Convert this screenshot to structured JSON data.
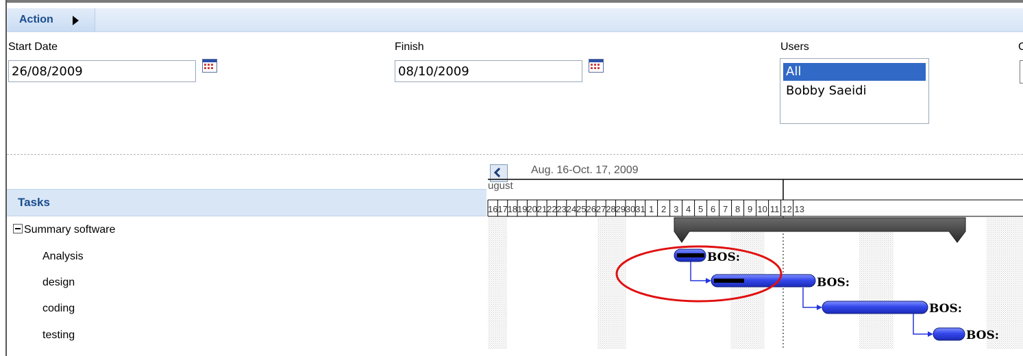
{
  "toolbar": {
    "action_label": "Action"
  },
  "filters": {
    "start_label": "Start Date",
    "start_value": "26/08/2009",
    "finish_label": "Finish",
    "finish_value": "08/10/2009",
    "users_label": "Users",
    "users_options": [
      "All",
      "Bobby Saeidi"
    ],
    "users_selected": "All",
    "cut_label": "C"
  },
  "tasks": {
    "header": "Tasks",
    "items": [
      {
        "label": "Summary software"
      },
      {
        "label": "Analysis"
      },
      {
        "label": "design"
      },
      {
        "label": "coding"
      },
      {
        "label": "testing"
      }
    ]
  },
  "gantt": {
    "range_label": "Aug. 16-Oct. 17, 2009",
    "month_label": "ugust",
    "day_labels": [
      "16",
      "17",
      "18",
      "19",
      "20",
      "21",
      "22",
      "23",
      "24",
      "25",
      "26",
      "27",
      "28",
      "29",
      "30",
      "31",
      "1",
      "2",
      "3",
      "4",
      "5",
      "6",
      "7",
      "8",
      "9",
      "10",
      "11",
      "12",
      "13"
    ],
    "bar_label": "BOS:",
    "colors": {
      "bar": "#2f3fe0",
      "progress": "#000000",
      "summary": "#3a3a3a",
      "annotation": "#e01010"
    }
  }
}
